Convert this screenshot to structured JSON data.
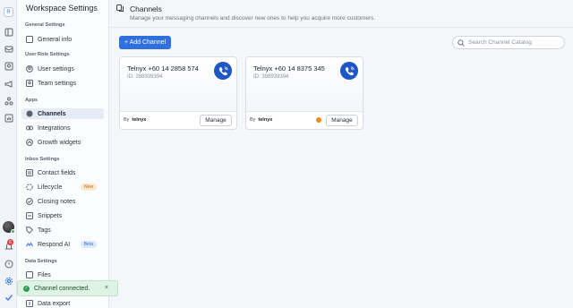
{
  "sidebar": {
    "title": "Workspace Settings",
    "sections": [
      {
        "label": "General Settings"
      },
      {
        "label": "User Role Settings"
      },
      {
        "label": "Apps"
      },
      {
        "label": "Inbox Settings"
      },
      {
        "label": "Data Settings"
      }
    ],
    "items": {
      "general_info": "General info",
      "user_settings": "User settings",
      "team_settings": "Team settings",
      "channels": "Channels",
      "integrations": "Integrations",
      "growth_widgets": "Growth widgets",
      "contact_fields": "Contact fields",
      "lifecycle": "Lifecycle",
      "lifecycle_badge": "New",
      "closing_notes": "Closing notes",
      "snippets": "Snippets",
      "tags": "Tags",
      "respond_ai": "Respond AI",
      "respond_ai_badge": "Beta",
      "files": "Files",
      "data_export": "Data export"
    }
  },
  "rail": {
    "logo": "R",
    "notification_count": "6"
  },
  "header": {
    "title": "Channels",
    "subtitle": "Manage your messaging channels and discover new ones to help you acquire more customers."
  },
  "toolbar": {
    "add_label": "+ Add Channel",
    "search_placeholder": "Search Channel Catalog"
  },
  "channels": [
    {
      "name": "Telnyx +60 14 2858 574",
      "id": "ID: 398939394",
      "by": "By",
      "brand": "telnyx",
      "manage": "Manage",
      "warning": false
    },
    {
      "name": "Telnyx +60 14 8375 345",
      "id": "ID: 398939394",
      "by": "By",
      "brand": "telnyx",
      "manage": "Manage",
      "warning": true
    }
  ],
  "toast": {
    "message": "Channel connected.",
    "close": "×"
  },
  "colors": {
    "accent": "#2f6fe0",
    "channel_icon": "#1f56c6",
    "warning": "#f08c1a",
    "success": "#2a9d4e"
  }
}
